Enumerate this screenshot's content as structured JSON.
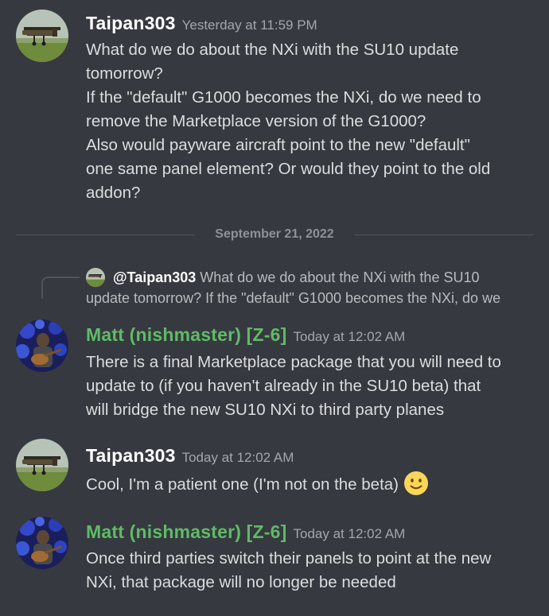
{
  "messages": [
    {
      "author": "Taipan303",
      "timestamp": "Yesterday at 11:59 PM",
      "lines": [
        "What do we do about the NXi with the SU10 update",
        "tomorrow?",
        "If the \"default\" G1000 becomes the NXi, do we need to",
        "remove the Marketplace version of the G1000?",
        "Also would payware aircraft point to the new \"default\"",
        "one same panel element? Or would they point to the old",
        "addon?"
      ]
    },
    {
      "author": "Matt (nishmaster) [Z-6]",
      "timestamp": "Today at 12:02 AM",
      "lines": [
        "There is a final Marketplace package that you will need to",
        "update to (if you haven't already in the SU10 beta) that",
        "will bridge the new SU10 NXi to third party planes"
      ]
    },
    {
      "author": "Taipan303",
      "timestamp": "Today at 12:02 AM",
      "lines": [
        "Cool, I'm a patient one (I'm not on the beta)"
      ],
      "emoji": "slightly-smiling-face"
    },
    {
      "author": "Matt (nishmaster) [Z-6]",
      "timestamp": "Today at 12:02 AM",
      "lines": [
        "Once third parties switch their panels to point at the new",
        "NXi, that package will no longer be needed"
      ]
    }
  ],
  "divider": {
    "date": "September 21, 2022"
  },
  "reply": {
    "mention": "@Taipan303",
    "preview_line1": "What do we do about the NXi with the SU10",
    "preview_line2": "update tomorrow?  If the \"default\" G1000 becomes the NXi, do we"
  },
  "colors": {
    "background": "#36393f",
    "author_default": "#ffffff",
    "author_role": "#5fbb67",
    "timestamp": "#a3a6aa",
    "body": "#dcddde"
  }
}
